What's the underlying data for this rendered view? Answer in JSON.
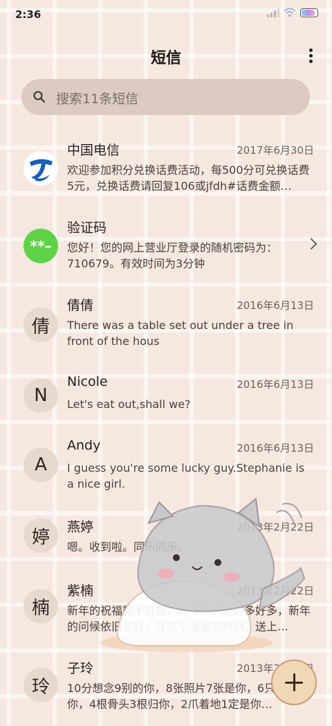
{
  "status_bar": {
    "time": "2:36"
  },
  "header": {
    "title": "短信"
  },
  "search": {
    "placeholder": "搜索11条短信"
  },
  "conversations": [
    {
      "name": "中国电信",
      "date": "2017年6月30日",
      "preview": "欢迎参加积分兑换话费活动，每500分可兑换话费5元，兑换话费请回复106或jfdh#话费金额…",
      "avatar": "china-telecom-logo"
    },
    {
      "name": "验证码",
      "date": "",
      "preview": "您好！您的网上营业厅登录的随机密码为：710679。有效时间为3分钟",
      "avatar_text": "**–"
    },
    {
      "name": "倩倩",
      "date": "2016年6月13日",
      "preview": "There was a table set out under a tree in front of the hous",
      "avatar_text": "倩"
    },
    {
      "name": "Nicole",
      "date": "2016年6月13日",
      "preview": "Let's eat out,shall we?",
      "avatar_text": "N"
    },
    {
      "name": "Andy",
      "date": "2016年6月13日",
      "preview": "I guess you're some lucky guy.Stephanie is a nice girl.",
      "avatar_text": "A"
    },
    {
      "name": "燕婷",
      "date": "2013年2月22日",
      "preview": "嗯。收到啦。同乐同乐。",
      "avatar_text": "婷"
    },
    {
      "name": "紫楠",
      "date": "2013年2月22日",
      "preview": "新年的祝福数不胜数，新年的愿望好多好多，新年的问候依旧美好，在这个温馨的时刻，送上…",
      "avatar_text": "楠"
    },
    {
      "name": "子玲",
      "date": "2013年2月22日",
      "preview": "10分想念9别的你，8张照片7张是你，6只…只像你，4根骨头3根归你，2爪着地1定是你…",
      "avatar_text": "玲"
    }
  ],
  "colors": {
    "verify_avatar": "#5fd247",
    "fab": "#f0d7b5",
    "background": "#f6e8e1"
  }
}
